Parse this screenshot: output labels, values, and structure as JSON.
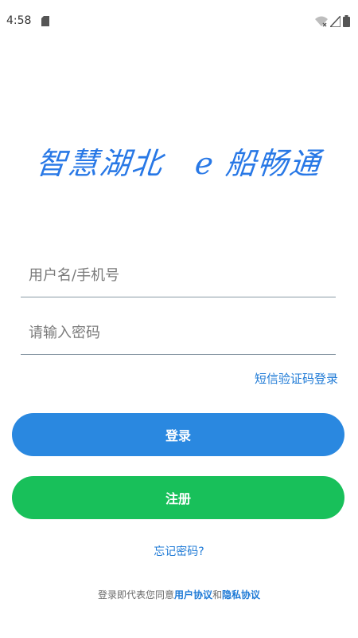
{
  "status_bar": {
    "time": "4:58",
    "icons": [
      "sd-card-icon",
      "wifi-off-icon",
      "signal-icon",
      "battery-icon"
    ]
  },
  "logo": {
    "text": "智慧湖北　e 船畅通",
    "color": "#2878e6"
  },
  "login_form": {
    "username_placeholder": "用户名/手机号",
    "password_placeholder": "请输入密码",
    "sms_login_link": "短信验证码登录",
    "login_button": "登录",
    "register_button": "注册",
    "forgot_password": "忘记密码?"
  },
  "agreement": {
    "prefix": "登录即代表您同意",
    "user_agreement": "用户协议",
    "and": "和",
    "privacy_policy": "隐私协议"
  },
  "colors": {
    "primary": "#2a88e0",
    "register": "#18c05a",
    "link": "#1e7ad6"
  }
}
